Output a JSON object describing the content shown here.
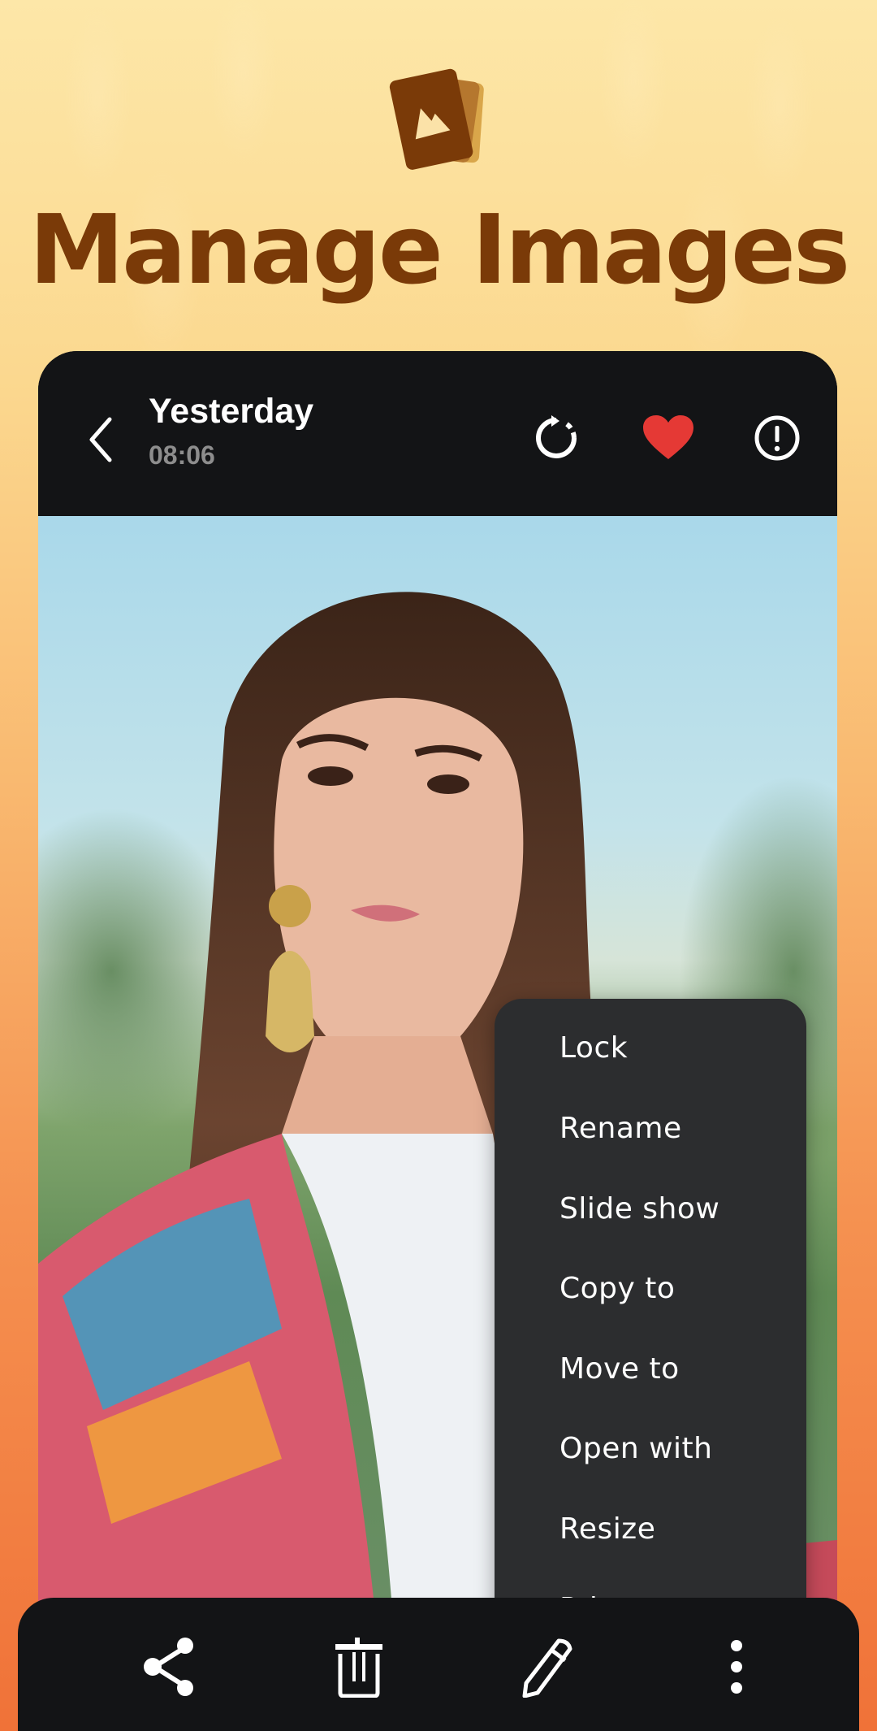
{
  "promo": {
    "headline": "Manage Images",
    "logo_icon": "gallery-icon",
    "colors": {
      "headline": "#7a3a08",
      "logo_front": "#7a3a08",
      "logo_back": "#c08a3e"
    }
  },
  "viewer": {
    "header": {
      "title": "Yesterday",
      "time": "08:06",
      "icons": [
        "back-icon",
        "rotate-icon",
        "heart-icon",
        "info-icon"
      ],
      "favorite": true,
      "favorite_color": "#e53935"
    },
    "photo_description": "Portrait of a smiling woman with long brown hair, gold earrings, colorful embroidered top",
    "context_menu": {
      "items": [
        {
          "label": "Lock"
        },
        {
          "label": "Rename"
        },
        {
          "label": "Slide show"
        },
        {
          "label": "Copy to"
        },
        {
          "label": "Move to"
        },
        {
          "label": "Open with"
        },
        {
          "label": "Resize"
        },
        {
          "label": "Print"
        }
      ]
    },
    "bottom_bar": {
      "icons": [
        "share-icon",
        "delete-icon",
        "edit-icon",
        "more-icon"
      ]
    }
  }
}
